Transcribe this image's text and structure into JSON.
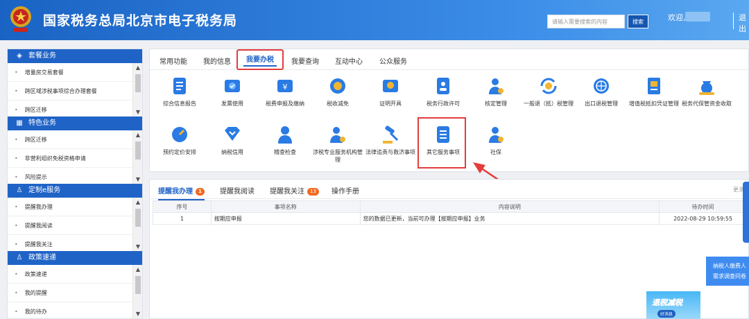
{
  "header": {
    "title": "国家税务总局北京市电子税务局",
    "search_placeholder": "请输入需要搜索的内容",
    "search_button": "搜索",
    "welcome": "欢迎,",
    "logout": "退出"
  },
  "sidebar": {
    "sections": [
      {
        "title": "套餐业务",
        "icon": "cube-icon",
        "items": [
          "增量房交易套餐",
          "跨区域涉税事项综合办理套餐",
          "跨区迁移"
        ]
      },
      {
        "title": "特色业务",
        "icon": "grid-icon",
        "items": [
          "跨区迁移",
          "非营利组织免税资格申请",
          "风险提示"
        ]
      },
      {
        "title": "定制e服务",
        "icon": "user-icon",
        "items": [
          "提醒我办理",
          "提醒我阅读",
          "提醒我关注"
        ]
      },
      {
        "title": "政策速递",
        "icon": "user-icon",
        "items": [
          "政策速递",
          "我的提醒",
          "我的待办"
        ]
      }
    ]
  },
  "main_tabs": [
    "常用功能",
    "我的信息",
    "我要办税",
    "我要查询",
    "互动中心",
    "公众服务"
  ],
  "services": [
    {
      "label": "综合信息报告",
      "icon": "report-icon"
    },
    {
      "label": "发票使用",
      "icon": "invoice-icon"
    },
    {
      "label": "税费申报及缴纳",
      "icon": "tax-payment-icon"
    },
    {
      "label": "税收减免",
      "icon": "tax-relief-icon"
    },
    {
      "label": "证明开具",
      "icon": "certificate-icon"
    },
    {
      "label": "税务行政许可",
      "icon": "license-icon"
    },
    {
      "label": "核定管理",
      "icon": "assessment-icon"
    },
    {
      "label": "一般退（抵）税管理",
      "icon": "refund-icon"
    },
    {
      "label": "出口退税管理",
      "icon": "export-refund-icon"
    },
    {
      "label": "增值税抵扣凭证管理",
      "icon": "vat-voucher-icon"
    },
    {
      "label": "税务代保管资金收取",
      "icon": "custody-fund-icon"
    },
    {
      "label": "预约定价安排",
      "icon": "pricing-icon"
    },
    {
      "label": "纳税信用",
      "icon": "credit-icon"
    },
    {
      "label": "稽查检查",
      "icon": "inspection-icon"
    },
    {
      "label": "涉税专业服务机构管理",
      "icon": "agency-icon"
    },
    {
      "label": "法律追责与救济事项",
      "icon": "law-icon"
    },
    {
      "label": "其它服务事项",
      "icon": "other-services-icon"
    },
    {
      "label": "社保",
      "icon": "social-security-icon"
    }
  ],
  "reminder_tabs": [
    {
      "label": "提醒我办理",
      "badge": "1"
    },
    {
      "label": "提醒我阅读",
      "badge": ""
    },
    {
      "label": "提醒我关注",
      "badge": "13"
    },
    {
      "label": "操作手册",
      "badge": ""
    }
  ],
  "more": "更多",
  "table": {
    "headers": [
      "序号",
      "事项名称",
      "内容说明",
      "待办时间"
    ],
    "rows": [
      [
        "1",
        "按期应申报",
        "您的数据已更新，当前可办理【按期应申报】业务",
        "2022-08-29 10:59:55"
      ]
    ]
  },
  "float_notice": [
    "纳税人缴费人",
    "需求调查问卷"
  ],
  "promo": {
    "title": "退税减税",
    "subtitle": "好消息"
  },
  "colors": {
    "brand": "#1f63c7",
    "highlight": "#e43b3b",
    "badge": "#f06b25"
  }
}
